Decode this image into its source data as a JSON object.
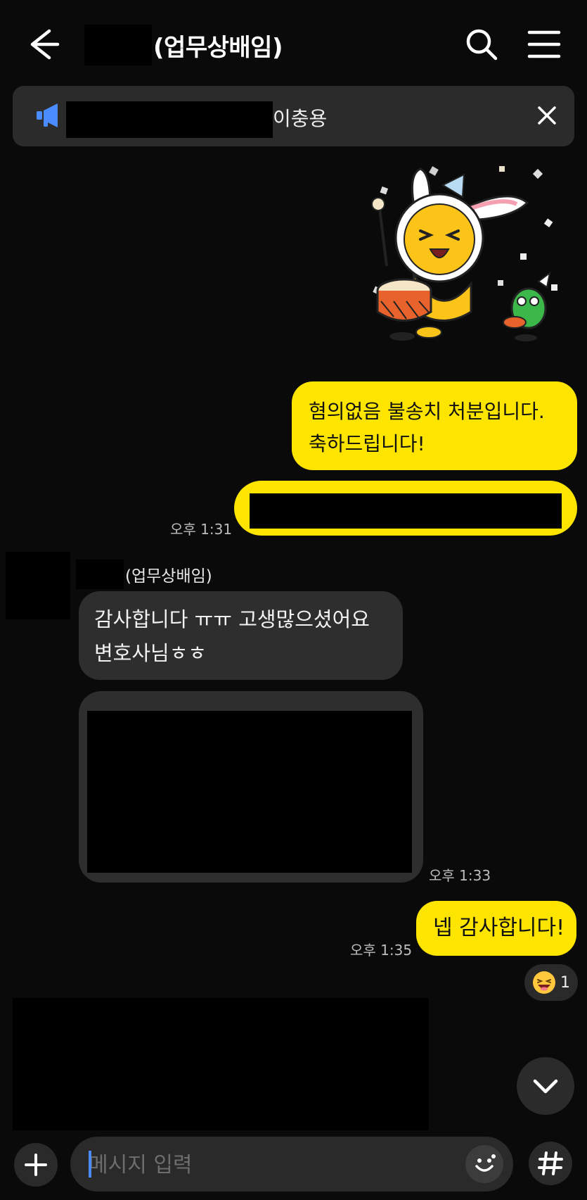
{
  "header": {
    "title_suffix": "(업무상배임)",
    "back_icon": "arrow-left-icon",
    "search_icon": "search-icon",
    "menu_icon": "menu-icon"
  },
  "notice": {
    "name": "이충용",
    "icon": "megaphone-icon",
    "close_icon": "close-icon"
  },
  "messages": {
    "m1_line1": "혐의없음 불송치 처분입니다.",
    "m1_line2": "축하드립니다!",
    "t1": "오후 1:31",
    "sender_suffix": "(업무상배임)",
    "m3_line1": "감사합니다 ㅠㅠ 고생많으셨어요",
    "m3_line2": "변호사님ㅎㅎ",
    "t2": "오후 1:33",
    "m5": "넵 감사합니다!",
    "t3": "오후 1:35",
    "reaction_count": "1"
  },
  "composer": {
    "placeholder": "메시지 입력",
    "plus_icon": "plus-icon",
    "emoji_icon": "emoji-icon",
    "hash_icon": "hash-icon"
  },
  "colors": {
    "background": "#0a0a0a",
    "yellow_bubble": "#fee500",
    "dark_bubble": "#2e2e2e",
    "notice_bg": "#2b2b2b",
    "accent_blue": "#4a8cff"
  }
}
